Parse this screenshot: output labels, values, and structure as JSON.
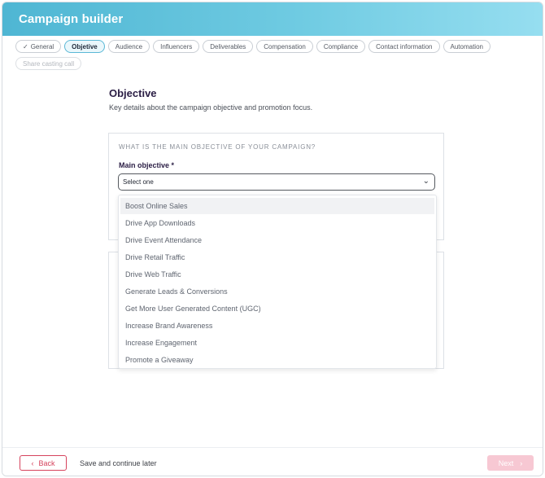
{
  "header": {
    "title": "Campaign builder"
  },
  "steps": [
    {
      "label": "General",
      "state": "completed",
      "icon": "check-icon"
    },
    {
      "label": "Objetive",
      "state": "active"
    },
    {
      "label": "Audience",
      "state": "default"
    },
    {
      "label": "Influencers",
      "state": "default"
    },
    {
      "label": "Deliverables",
      "state": "default"
    },
    {
      "label": "Compensation",
      "state": "default"
    },
    {
      "label": "Compliance",
      "state": "default"
    },
    {
      "label": "Contact information",
      "state": "default"
    },
    {
      "label": "Automation",
      "state": "default"
    },
    {
      "label": "Share casting call",
      "state": "disabled"
    }
  ],
  "section": {
    "title": "Objective",
    "description": "Key details about the campaign objective and promotion focus."
  },
  "objective_card": {
    "eyebrow": "WHAT IS THE MAIN OBJECTIVE OF YOUR CAMPAIGN?",
    "field_label": "Main objective *",
    "select_value": "Select one"
  },
  "dropdown": {
    "options": [
      "Boost Online Sales",
      "Drive App Downloads",
      "Drive Event Attendance",
      "Drive Retail Traffic",
      "Drive Web Traffic",
      "Generate Leads & Conversions",
      "Get More User Generated Content (UGC)",
      "Increase Brand Awareness",
      "Increase Engagement",
      "Promote a Giveaway"
    ],
    "highlighted": "Boost Online Sales"
  },
  "footer": {
    "back_label": "Back",
    "save_later_label": "Save and continue later",
    "next_label": "Next"
  },
  "colors": {
    "header_gradient_start": "#4fb6d3",
    "header_gradient_end": "#96def0",
    "accent_red": "#d6435d",
    "next_disabled": "#f7c8d3",
    "active_step_border": "#5bb8d6"
  }
}
